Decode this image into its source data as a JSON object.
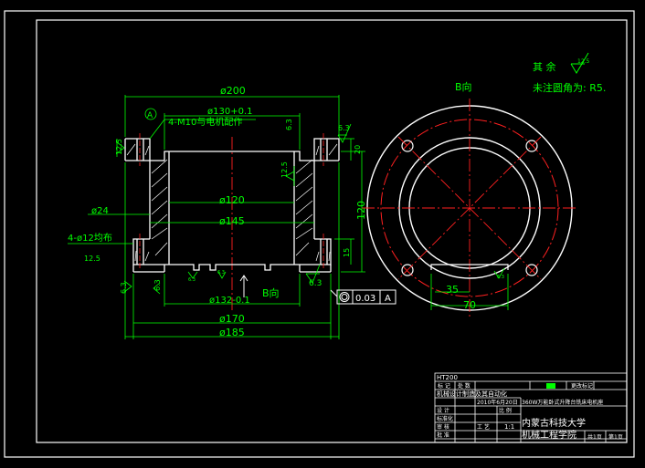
{
  "colors": {
    "background": "#000000",
    "frame": "#ffffff",
    "green": "#00ff00",
    "red": "#ff2020",
    "cyan": "#00ffff",
    "white": "#ffffff"
  },
  "notes": {
    "qiyu": "其 余",
    "qiyu_value": "12.5",
    "rounding": "未注圆角为: R5."
  },
  "views": {
    "b_view_label": "B向",
    "b_arrow_label": "B向"
  },
  "dims": {
    "d200": "ø200",
    "d130": "ø130+0.1",
    "d120": "ø120",
    "d145": "ø145",
    "d132": "ø132-0.1",
    "d170": "ø170",
    "d185": "ø185",
    "d24": "ø24",
    "holes12": "4-ø12均布",
    "holes12_ra": "12.5",
    "m10": "4-M10与电机配作",
    "datum": "A",
    "h120": "120",
    "h20": "20",
    "h15": "15",
    "ra_left": "12.5",
    "ra_right": "12.5",
    "ra_63_a": "6.3",
    "ra_63_b": "6.3",
    "ra_63_c": "6.3",
    "ra_63_d": "6.3",
    "small_ra_1": "6.3",
    "small_ra_2": "6.3",
    "d35": "35",
    "d70": "70",
    "flatness_tol": "0.03",
    "flatness_datum": "A"
  },
  "title_block": {
    "material": "HT200",
    "r1c1": "标 记",
    "r1c2": "处 数",
    "r1c3": "",
    "r1c4": "",
    "r1c5": "",
    "r1c6": "",
    "r1c7": "更改标记",
    "project": "机械设计制造及其自动化",
    "date": "2010年6月20日",
    "title": "360W万能卧式升降台铣床电机座",
    "design": "设 计",
    "standard": "标准化",
    "scale_label": "比 例",
    "scale": "1:1",
    "review": "审 核",
    "process": "工 艺",
    "approve": "批 准",
    "school1": "内蒙古科技大学",
    "school2": "机械工程学院",
    "sheets": "共1页",
    "page": "第1页"
  }
}
